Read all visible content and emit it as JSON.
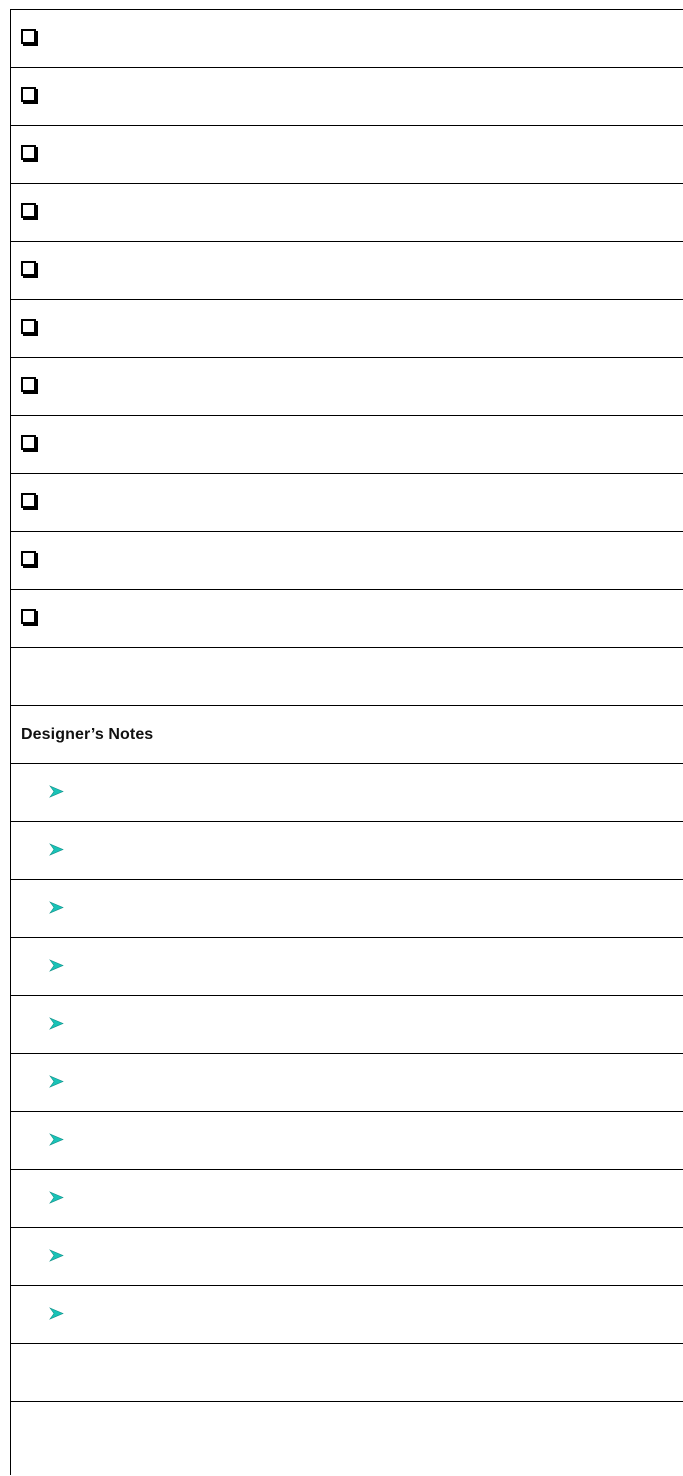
{
  "checklist": {
    "items": [
      {
        "checked": false,
        "text": ""
      },
      {
        "checked": false,
        "text": ""
      },
      {
        "checked": false,
        "text": ""
      },
      {
        "checked": false,
        "text": ""
      },
      {
        "checked": false,
        "text": ""
      },
      {
        "checked": false,
        "text": ""
      },
      {
        "checked": false,
        "text": ""
      },
      {
        "checked": false,
        "text": ""
      },
      {
        "checked": false,
        "text": ""
      },
      {
        "checked": false,
        "text": ""
      },
      {
        "checked": false,
        "text": ""
      }
    ]
  },
  "notes": {
    "heading": "Designer’s Notes",
    "bullet_icon": "arrowhead-bullet-icon",
    "bullet_color": "#19c3b7",
    "items": [
      {
        "text": ""
      },
      {
        "text": ""
      },
      {
        "text": ""
      },
      {
        "text": ""
      },
      {
        "text": ""
      },
      {
        "text": ""
      },
      {
        "text": ""
      },
      {
        "text": ""
      },
      {
        "text": ""
      },
      {
        "text": ""
      }
    ]
  }
}
